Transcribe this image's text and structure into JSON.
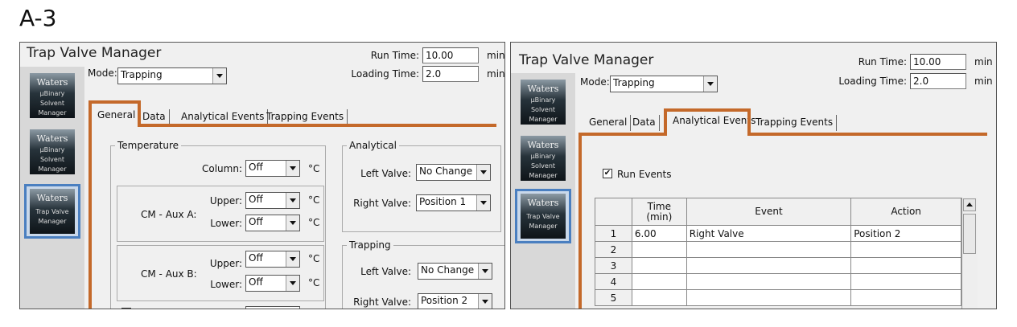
{
  "figure_label": "A-3",
  "accent_color": "#c4692a",
  "selection_color": "#4a7fc0",
  "left_panel": {
    "title": "Trap Valve Manager",
    "mode_label": "Mode:",
    "mode_value": "Trapping",
    "run_time_label": "Run Time:",
    "run_time_value": "10.00",
    "run_time_unit": "min",
    "loading_time_label": "Loading Time:",
    "loading_time_value": "2.0",
    "loading_time_unit": "min",
    "sidebar": [
      {
        "logo": "Waters",
        "line1": "µBinary",
        "line2": "Solvent",
        "line3": "Manager"
      },
      {
        "logo": "Waters",
        "line1": "µBinary",
        "line2": "Solvent",
        "line3": "Manager"
      },
      {
        "logo": "Waters",
        "line1": "Trap Valve",
        "line2": "Manager",
        "line3": ""
      }
    ],
    "tabs": [
      "General",
      "Data",
      "Analytical Events",
      "Trapping Events"
    ],
    "active_tab": "General",
    "temperature": {
      "title": "Temperature",
      "column_label": "Column:",
      "column_value": "Off",
      "unit": "°C",
      "aux_a": {
        "label": "CM - Aux A:",
        "upper_label": "Upper:",
        "upper_value": "Off",
        "lower_label": "Lower:",
        "lower_value": "Off"
      },
      "aux_b": {
        "label": "CM - Aux B:",
        "upper_label": "Upper:",
        "upper_value": "Off",
        "lower_label": "Lower:",
        "lower_value": "Off"
      }
    },
    "analytical": {
      "title": "Analytical",
      "left_valve_label": "Left Valve:",
      "left_valve_value": "No Change",
      "right_valve_label": "Right Valve:",
      "right_valve_value": "Position 1"
    },
    "trapping": {
      "title": "Trapping",
      "left_valve_label": "Left Valve:",
      "left_valve_value": "No Change",
      "right_valve_label": "Right Valve:",
      "right_valve_value": "Position 2"
    }
  },
  "right_panel": {
    "title": "Trap Valve Manager",
    "mode_label": "Mode:",
    "mode_value": "Trapping",
    "run_time_label": "Run Time:",
    "run_time_value": "10.00",
    "run_time_unit": "min",
    "loading_time_label": "Loading Time:",
    "loading_time_value": "2.0",
    "loading_time_unit": "min",
    "sidebar": [
      {
        "logo": "Waters",
        "line1": "µBinary",
        "line2": "Solvent",
        "line3": "Manager"
      },
      {
        "logo": "Waters",
        "line1": "µBinary",
        "line2": "Solvent",
        "line3": "Manager"
      },
      {
        "logo": "Waters",
        "line1": "Trap Valve",
        "line2": "Manager",
        "line3": ""
      }
    ],
    "tabs": [
      "General",
      "Data",
      "Analytical Events",
      "Trapping Events"
    ],
    "active_tab": "Analytical Events",
    "run_events_label": "Run Events",
    "run_events_checked": true,
    "table": {
      "col_time_line1": "Time",
      "col_time_line2": "(min)",
      "col_event": "Event",
      "col_action": "Action",
      "rows": [
        {
          "n": "1",
          "time": "6.00",
          "event": "Right Valve",
          "action": "Position 2"
        },
        {
          "n": "2",
          "time": "",
          "event": "",
          "action": ""
        },
        {
          "n": "3",
          "time": "",
          "event": "",
          "action": ""
        },
        {
          "n": "4",
          "time": "",
          "event": "",
          "action": ""
        },
        {
          "n": "5",
          "time": "",
          "event": "",
          "action": ""
        }
      ]
    }
  }
}
